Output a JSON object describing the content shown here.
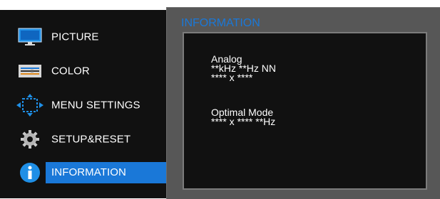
{
  "menu": {
    "items": [
      {
        "label": "PICTURE",
        "icon": "monitor-icon"
      },
      {
        "label": "COLOR",
        "icon": "color-sliders-icon"
      },
      {
        "label": "MENU SETTINGS",
        "icon": "move-arrows-icon"
      },
      {
        "label": "SETUP&RESET",
        "icon": "gear-icon"
      },
      {
        "label": "INFORMATION",
        "icon": "info-icon",
        "selected": true
      }
    ]
  },
  "info": {
    "title": "INFORMATION",
    "signal": {
      "input": "Analog",
      "frequency": "**kHz **Hz NN",
      "resolution": "**** x ****"
    },
    "optimal": {
      "label": "Optimal Mode",
      "value": "**** x **** **Hz"
    }
  },
  "colors": {
    "accent": "#1a78d8",
    "menu_background": "#111111",
    "panel_background": "#575757",
    "text": "#ffffff"
  }
}
